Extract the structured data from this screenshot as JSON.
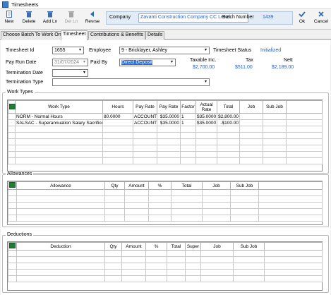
{
  "window": {
    "title": "Timesheets"
  },
  "toolbar": {
    "new": "New",
    "delete": "Delete",
    "add_ln": "Add Ln",
    "del_ln": "Del Ln",
    "reverse": "Revrse",
    "ok": "Ok",
    "cancel": "Cancel"
  },
  "header": {
    "company_label": "Company",
    "company_value": "Zavanti Construction Company CC Level",
    "batch_label": "Batch Number",
    "batch_value": "1439"
  },
  "tabs": [
    "Choose Batch To Work On",
    "Timesheet",
    "Contributions & Benefits",
    "Details"
  ],
  "form": {
    "timesheet_id_label": "Timesheet Id",
    "timesheet_id": "1655",
    "employee_label": "Employee",
    "employee": "9 - Bricklayer, Ashley",
    "status_label": "Timesheet Status",
    "status": "Initialized",
    "pay_run_date_label": "Pay Run Date",
    "pay_run_date": "31/07/2024",
    "paid_by_label": "Paid By",
    "paid_by": "Direct Deposit",
    "taxable_label": "Taxable Inc.",
    "taxable": "$2,700.00",
    "tax_label": "Tax",
    "tax": "$511.00",
    "nett_label": "Nett",
    "nett": "$2,189.00",
    "termination_date_label": "Termination Date",
    "termination_date": "",
    "termination_type_label": "Termination Type",
    "termination_type": ""
  },
  "work_types": {
    "title": "Work Types",
    "columns": [
      "Work Type",
      "Hours",
      "Pay Rate",
      "Pay Rate",
      "Factor",
      "Actual Rate",
      "Total",
      "Job",
      "Sub Job"
    ],
    "rows": [
      [
        "NORM - Normal Hours",
        "80.0000",
        "ACCOUNT",
        "$35.0000",
        "1",
        "$35.0000",
        "$2,800.00",
        "",
        ""
      ],
      [
        "SALSAC - Superannuation Salary Sacrifice",
        "",
        "ACCOUNT",
        "$35.0000",
        "1",
        "$35.0000",
        "-$100.00",
        "",
        ""
      ]
    ]
  },
  "allowances": {
    "title": "Allowances",
    "columns": [
      "Allowance",
      "Qty",
      "Amount",
      "%",
      "Total",
      "Job",
      "Sub Job"
    ]
  },
  "deductions": {
    "title": "Deductions",
    "columns": [
      "Deduction",
      "Qty",
      "Amount",
      "%",
      "Total",
      "Super",
      "Job",
      "Sub Job"
    ]
  },
  "icons": {
    "window": "timesheet-app-icon",
    "new": "new-doc-icon",
    "delete": "trash-icon",
    "add_ln": "trash-add-icon",
    "del_ln": "trash-disabled-icon",
    "reverse": "reverse-arrow-icon",
    "ok": "checkmark-icon",
    "cancel": "x-icon",
    "grid": "excel-icon"
  },
  "colors": {
    "accent": "#1e5fc5",
    "header_bg": "#e1ecf7",
    "selection": "#2f6cd6"
  }
}
